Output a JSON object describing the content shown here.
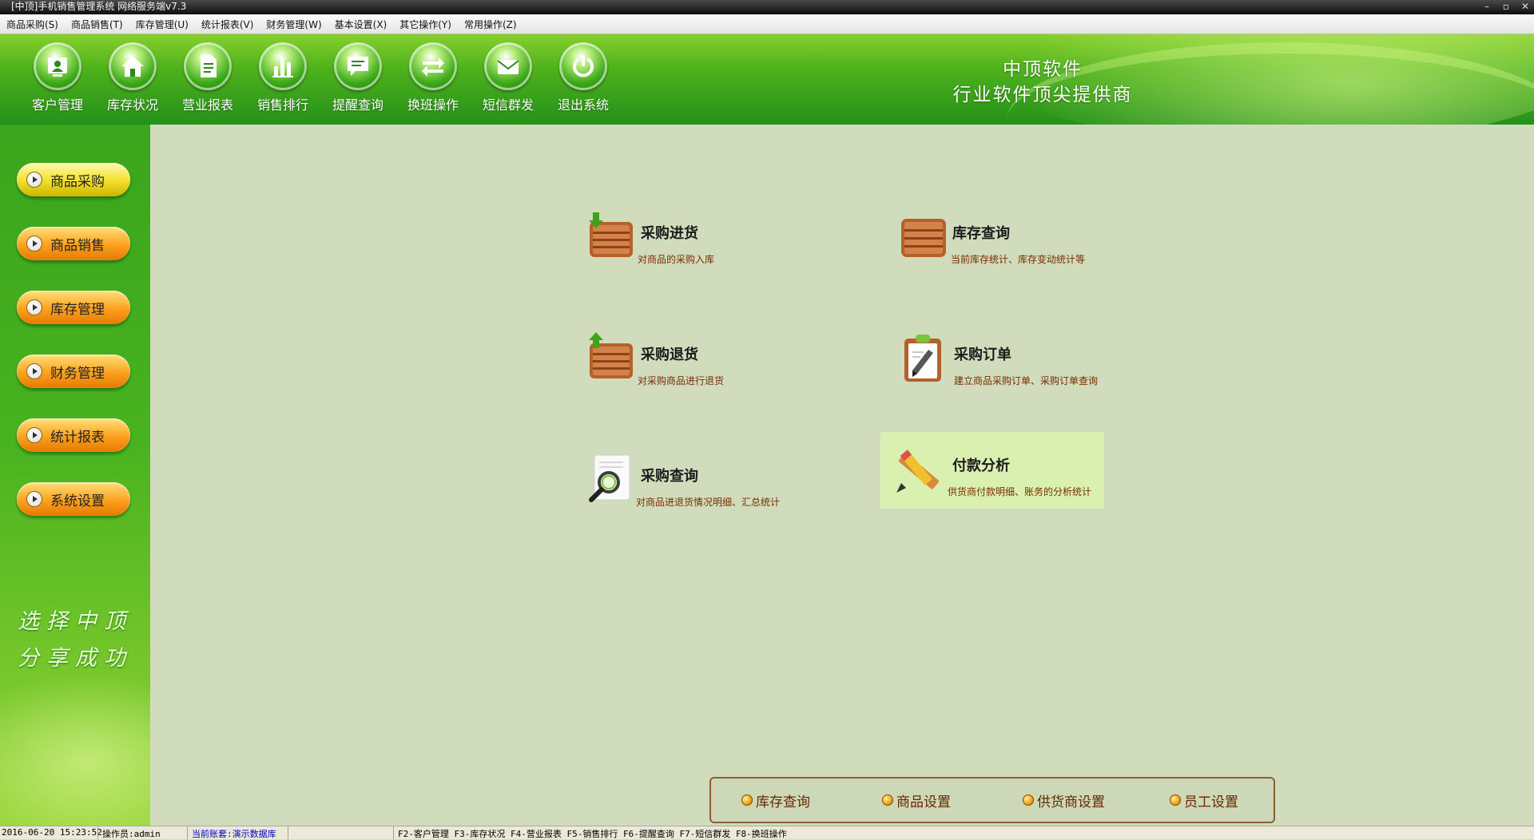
{
  "window": {
    "title": "[中顶]手机销售管理系统 网络服务端v7.3",
    "buttons": [
      "–",
      "▫",
      "✕"
    ]
  },
  "menu": [
    "商品采购(S)",
    "商品销售(T)",
    "库存管理(U)",
    "统计报表(V)",
    "财务管理(W)",
    "基本设置(X)",
    "其它操作(Y)",
    "常用操作(Z)"
  ],
  "toolbar": [
    {
      "label": "客户管理",
      "icon": "customer-icon"
    },
    {
      "label": "库存状况",
      "icon": "home-icon"
    },
    {
      "label": "营业报表",
      "icon": "report-icon"
    },
    {
      "label": "销售排行",
      "icon": "bar-chart-icon"
    },
    {
      "label": "提醒查询",
      "icon": "speech-bubble-icon"
    },
    {
      "label": "换班操作",
      "icon": "swap-arrows-icon"
    },
    {
      "label": "短信群发",
      "icon": "envelope-icon"
    },
    {
      "label": "退出系统",
      "icon": "power-icon"
    }
  ],
  "slogan": {
    "line1": "中顶软件",
    "line2": "行业软件顶尖提供商"
  },
  "sidebar": {
    "items": [
      {
        "label": "商品采购",
        "style": "yellow"
      },
      {
        "label": "商品销售",
        "style": "orange"
      },
      {
        "label": "库存管理",
        "style": "orange"
      },
      {
        "label": "财务管理",
        "style": "orange"
      },
      {
        "label": "统计报表",
        "style": "orange"
      },
      {
        "label": "系统设置",
        "style": "orange"
      }
    ],
    "motto": {
      "line1": "选择中顶",
      "line2": "分享成功"
    }
  },
  "tiles": [
    {
      "title": "采购进货",
      "desc": "对商品的采购入库",
      "icon": "crate-in-icon"
    },
    {
      "title": "库存查询",
      "desc": "当前库存统计、库存变动统计等",
      "icon": "crate-icon"
    },
    {
      "title": "采购退货",
      "desc": "对采购商品进行退货",
      "icon": "crate-return-icon"
    },
    {
      "title": "采购订单",
      "desc": "建立商品采购订单、采购订单查询",
      "icon": "clipboard-icon"
    },
    {
      "title": "采购查询",
      "desc": "对商品进退货情况明细、汇总统计",
      "icon": "magnifier-document-icon"
    },
    {
      "title": "付款分析",
      "desc": "供货商付款明细、账务的分析统计",
      "icon": "pencil-ruler-icon"
    }
  ],
  "quick_links": [
    "库存查询",
    "商品设置",
    "供货商设置",
    "员工设置"
  ],
  "status": {
    "datetime": "2016-06-20 15:23:52",
    "operator": "操作员:admin",
    "account_label": "当前账套:",
    "account_value": "演示数据库",
    "shortcuts": "F2-客户管理 F3-库存状况 F4-营业报表 F5-销售排行 F6-提醒查询 F7-短信群发 F8-换班操作"
  },
  "colors": {
    "banner": "#3aa51c",
    "content_bg": "#d0dcbc",
    "desc_text": "#7a2c00",
    "highlight_tile": "#daf0b0"
  }
}
